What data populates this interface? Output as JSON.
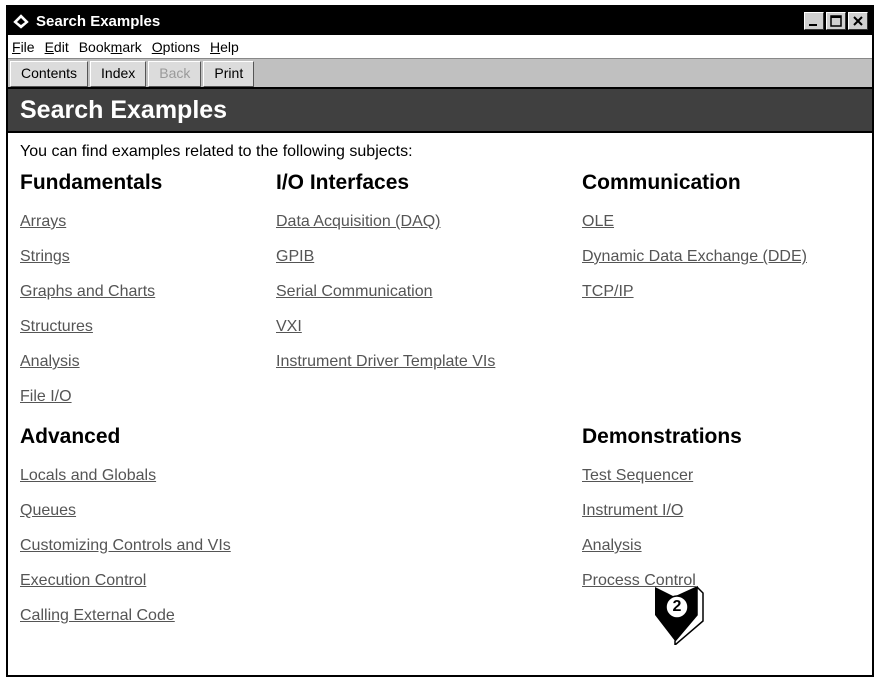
{
  "window": {
    "title": "Search Examples",
    "icon": "help-book-icon"
  },
  "menu": [
    "File",
    "Edit",
    "Bookmark",
    "Options",
    "Help"
  ],
  "toolbar": {
    "contents": "Contents",
    "index": "Index",
    "back": "Back",
    "print": "Print"
  },
  "page": {
    "header": "Search Examples",
    "intro": "You can find examples related to the following subjects:",
    "sections": {
      "fundamentals": {
        "title": "Fundamentals",
        "links": [
          "Arrays",
          "Strings",
          "Graphs and Charts",
          "Structures",
          "Analysis",
          "File I/O"
        ]
      },
      "io": {
        "title": "I/O Interfaces",
        "links": [
          "Data Acquisition (DAQ)",
          "GPIB",
          "Serial Communication",
          "VXI",
          "Instrument Driver Template VIs"
        ]
      },
      "communication": {
        "title": "Communication",
        "links": [
          "OLE",
          "Dynamic Data Exchange (DDE)",
          "TCP/IP"
        ]
      },
      "advanced": {
        "title": "Advanced",
        "links": [
          "Locals and Globals",
          "Queues",
          "Customizing Controls and VIs",
          "Execution Control",
          "Calling External Code"
        ]
      },
      "demonstrations": {
        "title": "Demonstrations",
        "links": [
          "Test Sequencer",
          "Instrument I/O",
          "Analysis",
          "Process Control"
        ]
      }
    }
  },
  "callout": {
    "number": "2"
  }
}
